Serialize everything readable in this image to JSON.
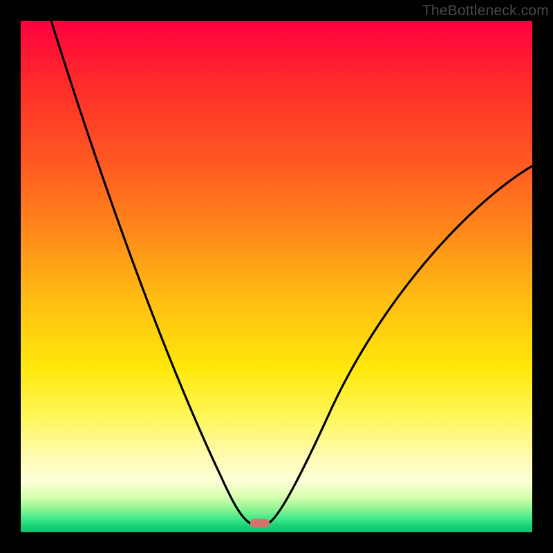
{
  "watermark": "TheBottleneck.com",
  "chart_data": {
    "type": "line",
    "title": "",
    "xlabel": "",
    "ylabel": "",
    "xlim": [
      0,
      100
    ],
    "ylim": [
      0,
      100
    ],
    "grid": false,
    "legend": false,
    "background": "vertical-gradient red→yellow→green",
    "annotations": [
      {
        "name": "optimal-marker",
        "x": 47,
        "y": 2,
        "color": "#d4756b"
      }
    ],
    "series": [
      {
        "name": "bottleneck-curve",
        "color": "#000000",
        "x": [
          6,
          10,
          14,
          18,
          22,
          26,
          30,
          34,
          38,
          40,
          42,
          43,
          44,
          45,
          46,
          47,
          48,
          49,
          50,
          52,
          55,
          60,
          65,
          70,
          75,
          80,
          85,
          90,
          95,
          100
        ],
        "y": [
          100,
          90,
          80,
          70,
          60,
          51,
          42,
          33,
          23,
          18,
          12,
          9,
          6,
          3.5,
          2,
          1.6,
          1.6,
          2,
          3,
          6,
          11,
          19,
          27,
          34,
          41,
          47,
          53,
          58,
          63,
          67
        ]
      }
    ]
  }
}
